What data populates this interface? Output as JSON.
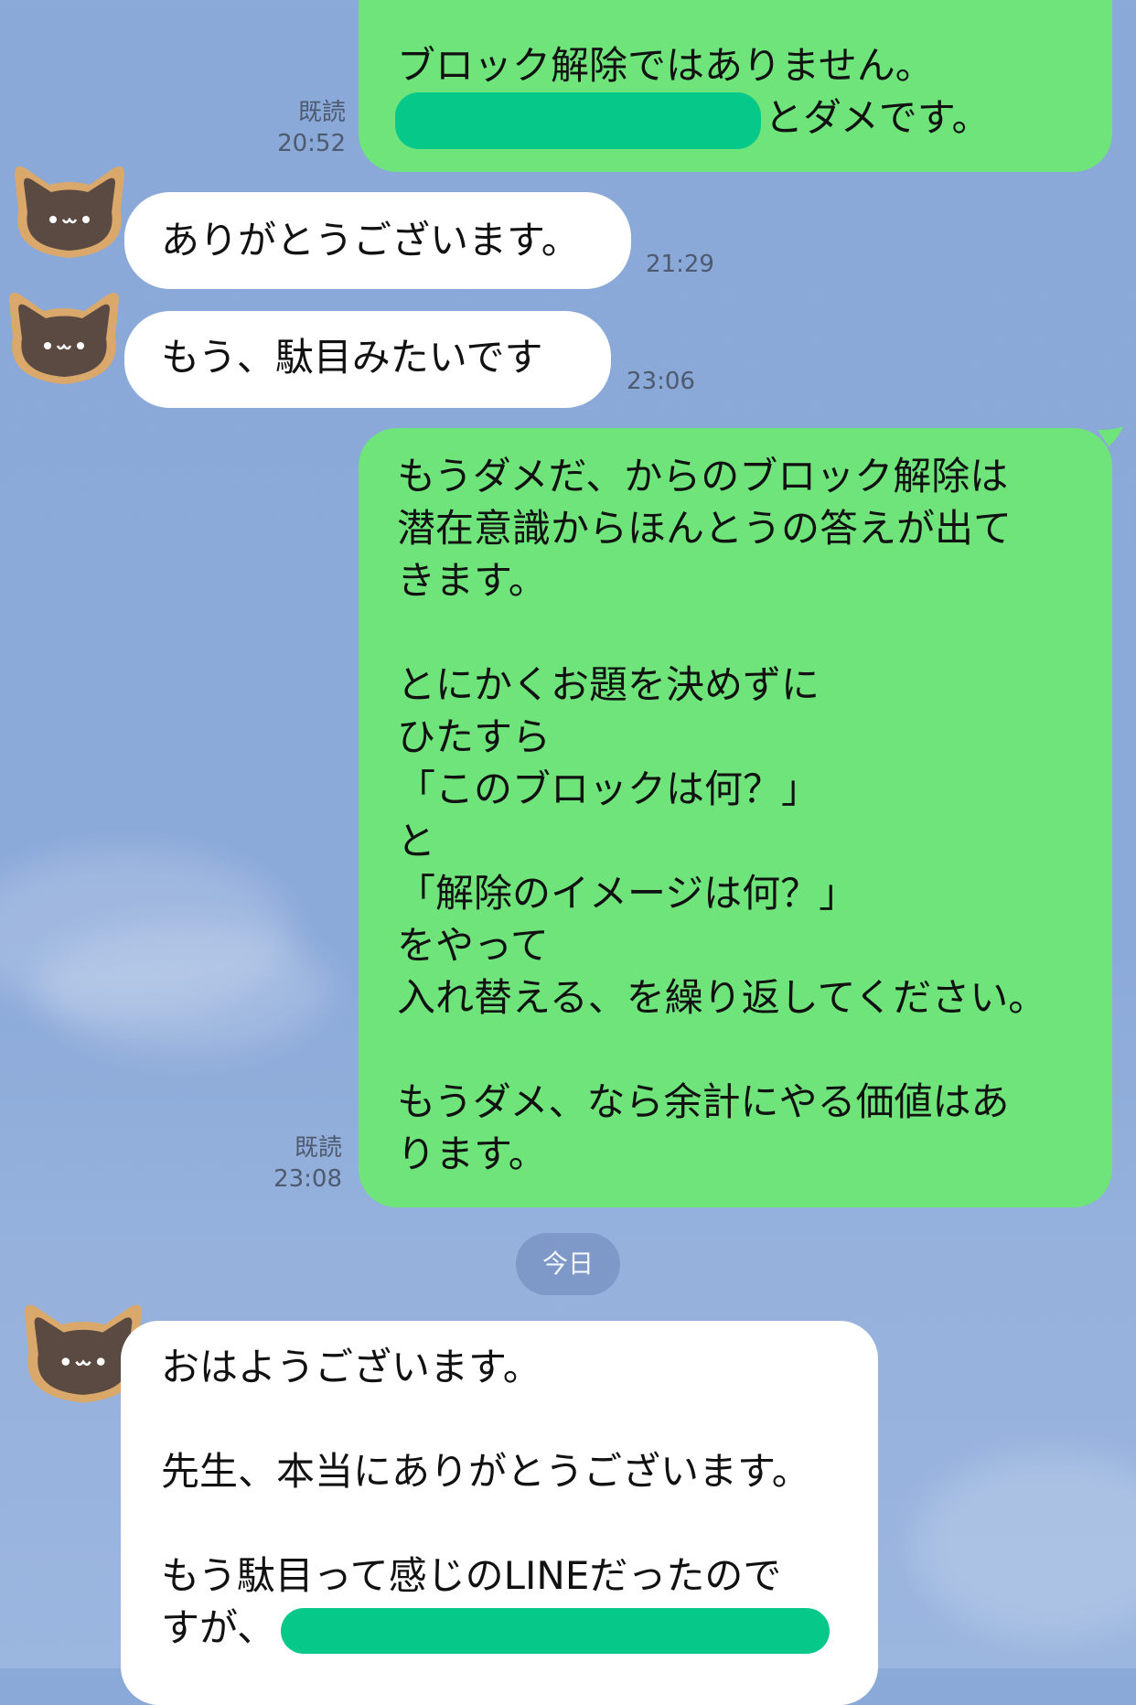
{
  "messages": [
    {
      "sender": "me",
      "lines": [
        "ブロック解除ではありません。"
      ],
      "redacted_prefix_line": "とダメです。",
      "read": "既読",
      "time": "20:52"
    },
    {
      "sender": "other",
      "avatar": "cat-face-icon",
      "lines": [
        "ありがとうございます。"
      ],
      "time": "21:29"
    },
    {
      "sender": "other",
      "avatar": "cat-face-icon",
      "lines": [
        "もう、駄目みたいです"
      ],
      "time": "23:06"
    },
    {
      "sender": "me",
      "lines": [
        "もうダメだ、からのブロック解除は",
        "潜在意識からほんとうの答えが出て",
        "きます。",
        "",
        "とにかくお題を決めずに",
        "ひたすら",
        "「このブロックは何？」",
        "と",
        "「解除のイメージは何？」",
        "をやって",
        "入れ替える、を繰り返してください。",
        "",
        "もうダメ、なら余計にやる価値はあ",
        "ります。"
      ],
      "read": "既読",
      "time": "23:08"
    },
    {
      "sender": "other",
      "avatar": "cat-face-icon",
      "lines": [
        "おはようございます。",
        "",
        "先生、本当にありがとうございます。",
        "",
        "もう駄目って感じのLINEだったので",
        "すが、"
      ]
    }
  ],
  "date_separator": "今日",
  "colors": {
    "outgoing_bubble": "#6ee47a",
    "incoming_bubble": "#ffffff",
    "redaction": "#06c888",
    "background": "#8aa8d8"
  }
}
